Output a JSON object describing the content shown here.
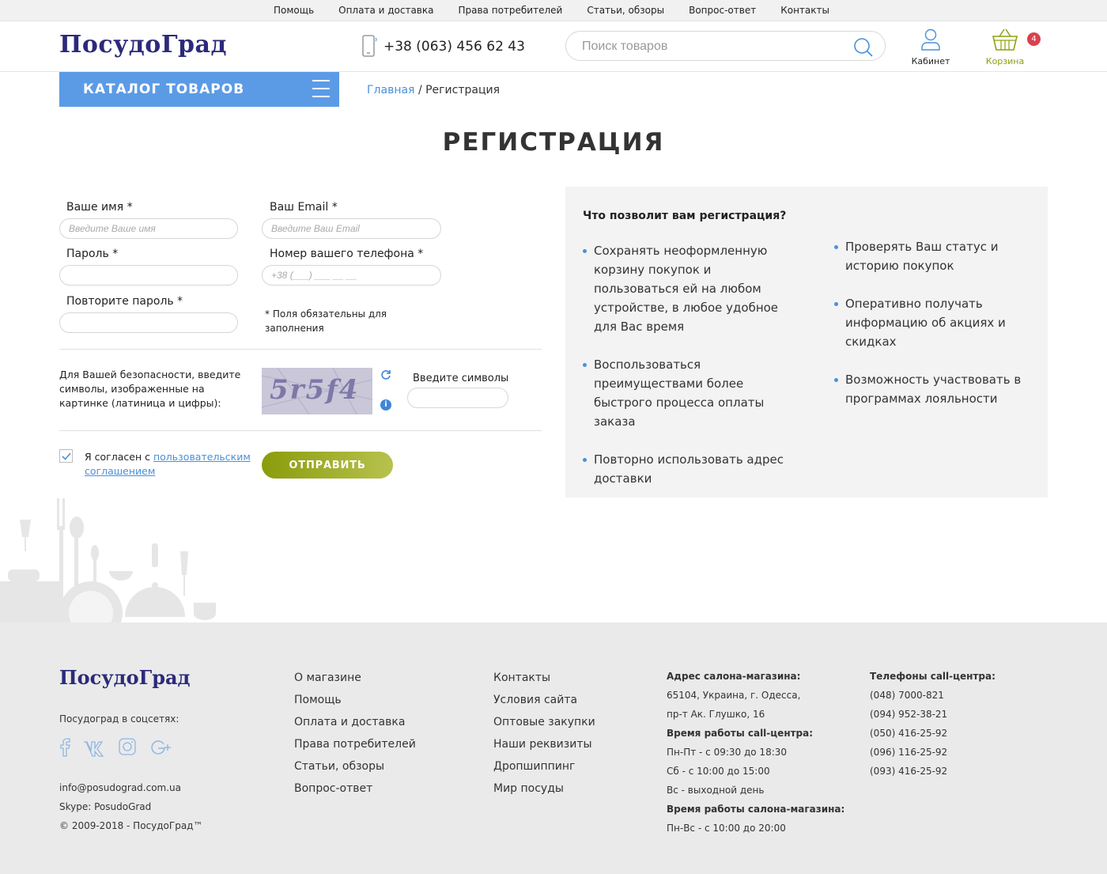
{
  "colors": {
    "accent": "#5b9be6",
    "link": "#4a90d9",
    "brand": "#2c2a7a",
    "cart": "#8fa010",
    "badge": "#d9414e",
    "submit": "#9aab1e"
  },
  "topbar": {
    "links": [
      "Помощь",
      "Оплата и доставка",
      "Права потребителей",
      "Статьи, обзоры",
      "Вопрос-ответ",
      "Контакты"
    ]
  },
  "header": {
    "logo": "ПосудоГрад",
    "phone": "+38 (063) 456 62 43",
    "search_placeholder": "Поиск товаров",
    "cabinet_label": "Кабинет",
    "cart_label": "Корзина",
    "cart_count": "4"
  },
  "catalog": {
    "label": "КАТАЛОГ ТОВАРОВ"
  },
  "breadcrumb": {
    "home": "Главная",
    "separator": "/",
    "current": "Регистрация"
  },
  "page_title": "РЕГИСТРАЦИЯ",
  "form": {
    "name_label": "Ваше имя *",
    "name_placeholder": "Введите Ваше имя",
    "email_label": "Ваш Email *",
    "email_placeholder": "Введите Ваш Email",
    "password_label": "Пароль *",
    "phone_label": "Номер вашего телефона *",
    "phone_placeholder": "+38 (___) ___ __ __",
    "repeat_label": "Повторите пароль *",
    "required_note": "* Поля обязательны для заполнения",
    "captcha_text": "Для Вашей безопасности, введите символы, изображенные на картинке (латиница и цифры):",
    "captcha_value": "5r5f4",
    "captcha_input_label": "Введите символы",
    "agree_text": "Я согласен с",
    "agree_link": "пользовательским соглашением",
    "submit": "ОТПРАВИТЬ"
  },
  "benefits": {
    "title": "Что позволит вам регистрация?",
    "left": [
      "Сохранять неоформленную корзину покупок и пользоваться ей на любом устройстве, в любое удобное для Вас время",
      "Воспользоваться преимуществами более быстрого процесса оплаты заказа",
      "Повторно использовать адрес доставки"
    ],
    "right": [
      "Проверять Ваш статус и историю покупок",
      "Оперативно получать информацию об акциях и скидках",
      "Возможность участвовать в программах лояльности"
    ]
  },
  "footer": {
    "logo": "ПосудоГрад",
    "social_title": "Посудоград в соцсетях:",
    "email": "info@posudograd.com.ua",
    "skype": "Skype: PosudoGrad",
    "copyright": "© 2009-2018 - ПосудоГрад™",
    "menu1": [
      "О магазине",
      "Помощь",
      "Оплата и доставка",
      "Права потребителей",
      "Статьи, обзоры",
      "Вопрос-ответ"
    ],
    "menu2": [
      "Контакты",
      "Условия сайта",
      "Оптовые закупки",
      "Наши реквизиты",
      "Дропшиппинг",
      "Мир посуды"
    ],
    "address": {
      "title": "Адрес салона-магазина:",
      "line1": "65104, Украина, г. Одесса,",
      "line2": "пр-т Ак. Глушко, 16",
      "callcenter_title": "Время работы call-центра:",
      "cc1": "Пн-Пт - с 09:30 до 18:30",
      "cc2": "Сб - с 10:00 до 15:00",
      "cc3": "Вс - выходной день",
      "salon_title": "Время работы салона-магазина:",
      "salon1": "Пн-Вс - с 10:00 до 20:00"
    },
    "phones": {
      "title": "Телефоны call-центра:",
      "list": [
        "(048) 7000-821",
        "(094) 952-38-21",
        "(050) 416-25-92",
        "(096) 116-25-92",
        "(093) 416-25-92"
      ]
    }
  }
}
